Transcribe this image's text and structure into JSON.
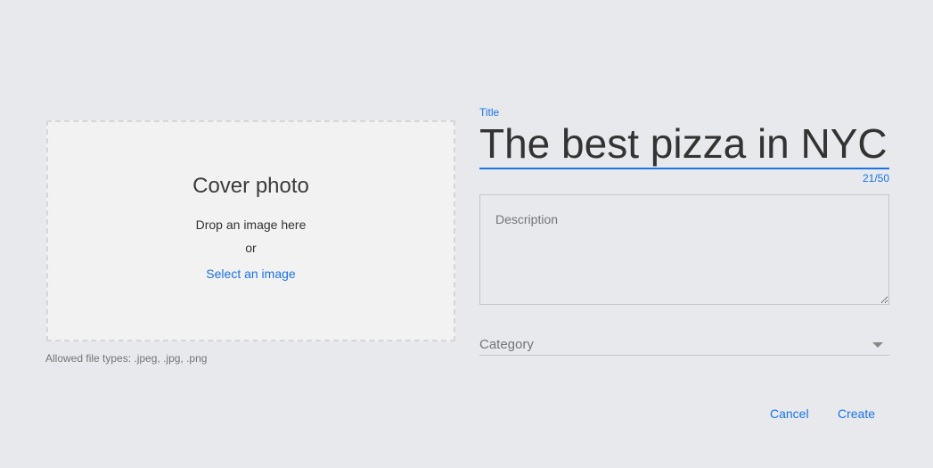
{
  "cover": {
    "title": "Cover photo",
    "drop_text": "Drop an image here",
    "or_text": "or",
    "select_label": "Select an image",
    "allowed_types": "Allowed file types: .jpeg, .jpg, .png"
  },
  "title_field": {
    "label": "Title",
    "value": "The best pizza in NYC",
    "counter": "21/50"
  },
  "description_field": {
    "placeholder": "Description"
  },
  "category_field": {
    "label": "Category"
  },
  "actions": {
    "cancel_label": "Cancel",
    "create_label": "Create"
  },
  "colors": {
    "accent": "#1a73e8",
    "background": "#e8e9ed",
    "dropzone_bg": "#f2f2f2"
  },
  "icons": {
    "category_caret": "caret-down-icon"
  }
}
